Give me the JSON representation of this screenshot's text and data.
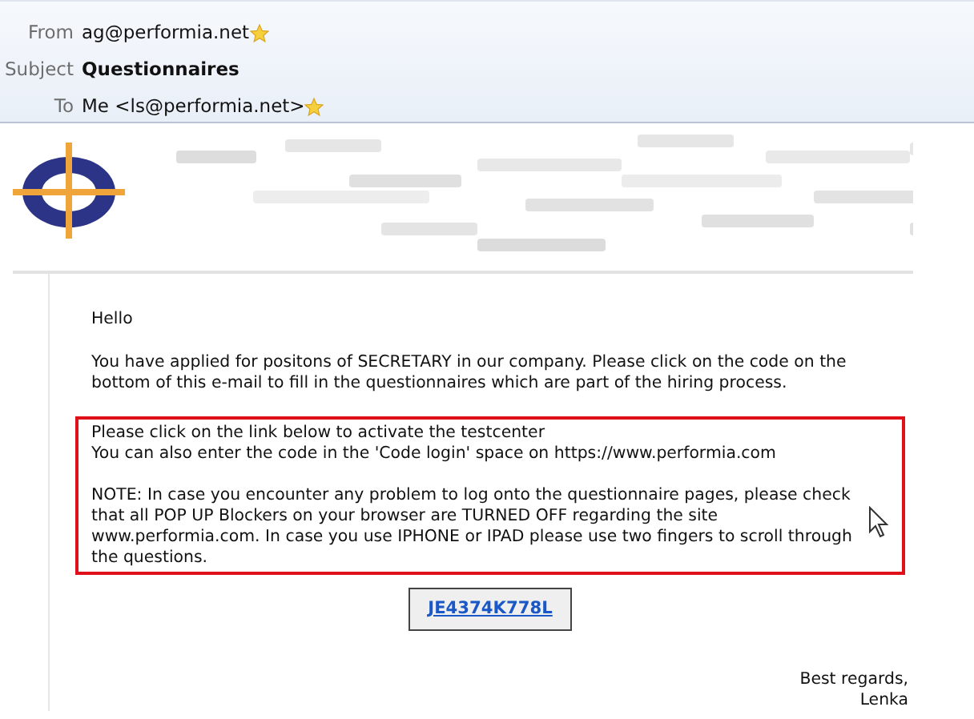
{
  "header": {
    "fields": [
      {
        "label": "From",
        "value": "ag@performia.net",
        "starred": true,
        "bold": false
      },
      {
        "label": "Subject",
        "value": "Questionnaires",
        "starred": false,
        "bold": true
      },
      {
        "label": "To",
        "value": "Me <ls@performia.net>",
        "starred": true,
        "bold": false
      }
    ]
  },
  "body": {
    "greeting": "Hello",
    "intro": "You have applied for positons of SECRETARY in our company. Please click on the code on the bottom of this e-mail to fill in the questionnaires which are part of the hiring process.",
    "notice": [
      "Please click on the link below to activate the testcenter",
      "You can also enter the code in the 'Code login' space on https://www.performia.com"
    ],
    "note": "NOTE: In case you encounter any problem to log onto the questionnaire pages, please check that all POP UP Blockers on your browser are TURNED OFF regarding the site www.performia.com. In case you use IPHONE or IPAD please use two fingers to scroll through the questions.",
    "code_link": "JE4374K778L",
    "signoff": [
      "Best regards,",
      "Lenka"
    ]
  }
}
